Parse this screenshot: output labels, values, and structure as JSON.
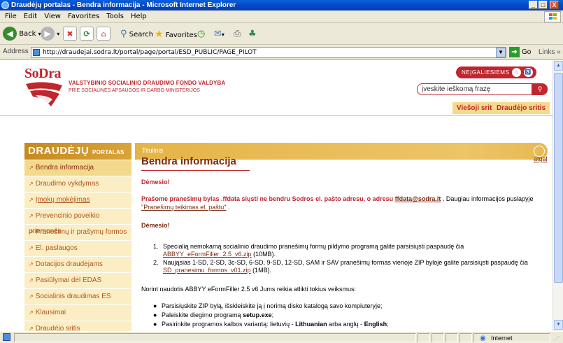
{
  "window": {
    "title": "Draudėjų portalas - Bendra informacija - Microsoft Internet Explorer",
    "min": "_",
    "max": "□",
    "close": "X"
  },
  "menu": [
    "File",
    "Edit",
    "View",
    "Favorites",
    "Tools",
    "Help"
  ],
  "toolbar": {
    "back": "Back",
    "search": "Search",
    "favorites": "Favorites"
  },
  "address": {
    "label": "Address",
    "url": "http://draudejai.sodra.lt/portal/page/portal/ESD_PUBLIC/PAGE_PILOT",
    "go": "Go",
    "links": "Links »"
  },
  "header": {
    "logo": "SoDra",
    "org_line1": "VALSTYBINIO SOCIALINIO DRAUDIMO FONDO VALDYBA",
    "org_line2": "PRIE SOCIALINĖS APSAUGOS IR DARBO MINISTERIJOS",
    "neigaliesiems": "NEĮGALIESIEMS",
    "search_placeholder": "įveskite ieškomą frazę",
    "tab_public": "Viešoji sritis",
    "tab_insurer": "Draudėjo sritis"
  },
  "sidebar": {
    "title_main": "DRAUDĖJŲ",
    "title_small": "PORTALAS",
    "items": [
      {
        "label": "Bendra informacija"
      },
      {
        "label": "Draudimo vykdymas"
      },
      {
        "label": "Įmokų mokėjimas"
      },
      {
        "label": "Prevencinio poveikio priemonės"
      },
      {
        "label": "Pranešimų ir prašymų formos"
      },
      {
        "label": "El. paslaugos"
      },
      {
        "label": "Dotacijos draudėjams"
      },
      {
        "label": "Pasiūlymai dėl EDAS"
      },
      {
        "label": "Socialinis draudimas ES"
      },
      {
        "label": "Klausimai"
      },
      {
        "label": "Draudėjo sritis"
      }
    ]
  },
  "content": {
    "bar_title": "Titulinis",
    "back_link": "atgal",
    "heading": "Bendra informacija",
    "attention1": "Dėmesio!",
    "para1_bold_a": "Prašome pranešimų bylas .ffdata siųsti ne bendru Sodros el. pašto adresu, o adresu ",
    "para1_email": "ffdata@sodra.lt",
    "para1_bold_b": " .",
    "para1_tail": " Daugiau informacijos puslapyje",
    "para1_link": "\"Pranešimų teikimas el. paštu\"",
    "para1_end": " .",
    "attention2": "Dėmesio!",
    "item1_num": "1.",
    "item1_text": "Specialią nemokamą socialinio draudimo pranešimų formų pildymo programą galite parsisiųsti paspaudę čia",
    "item1_link": "ABBYY_eFormFiller_2.5_v6.zip",
    "item1_size": " (10MB).",
    "item2_num": "2.",
    "item2_text": "Naująsias 1-SD, 2-SD, 3c-SD, 6-SD, 9-SD, 12-SD, SAM ir SAV pranešimų formas vienoje ZIP byloje galite parsisiųsti paspaudę čia",
    "item2_link": "SD_pranesimu_formos_v01.zip",
    "item2_size": " (1MB).",
    "para2": "Norint naudotis ABBYY eFormFiller 2.5 v6 Jums reikia atlikti tokius veiksmus:",
    "bullet1": "Parsisiųskite ZIP bylą, išskleiskite ją į norimą disko katalogą savo kompiuteryje;",
    "bullet2_a": "Paleiskite diegimo programą ",
    "bullet2_b": "setup.exe",
    "bullet2_c": ";",
    "bullet3_a": "Pasirinkite programos kalbos variantą: lietuvių - ",
    "bullet3_b": "Lithuanian",
    "bullet3_c": " arba anglų - ",
    "bullet3_d": "English",
    "bullet3_e": ";"
  },
  "status": {
    "zone": "Internet"
  },
  "colors": {
    "brand_red": "#c0262d",
    "gold": "#e5b448",
    "nav_bg": "#fbeec4"
  }
}
